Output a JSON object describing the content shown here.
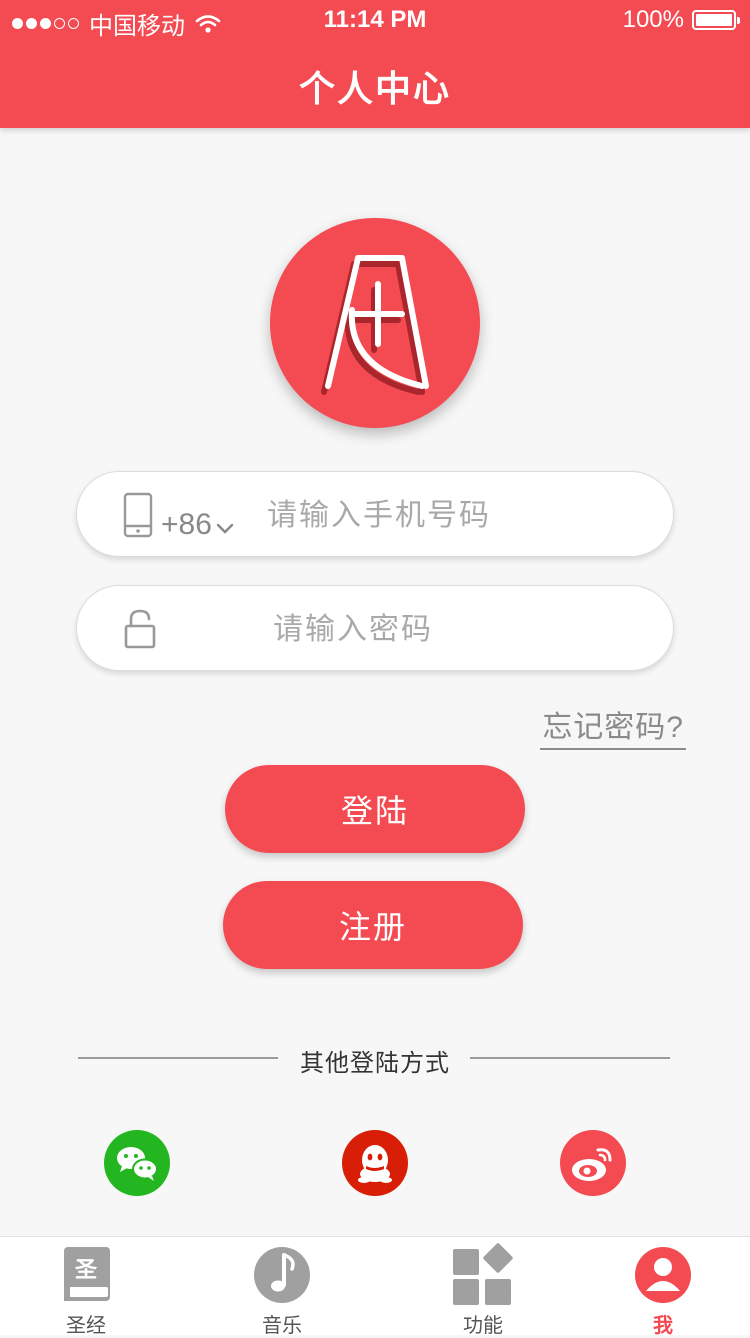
{
  "status_bar": {
    "carrier": "中国移动",
    "time": "11:14 PM",
    "battery": "100%",
    "signal_dots_filled": 3,
    "signal_dots_total": 5
  },
  "header": {
    "title": "个人中心"
  },
  "login_form": {
    "country_code": "+86",
    "phone_placeholder": "请输入手机号码",
    "phone_value": "",
    "password_placeholder": "请输入密码",
    "password_value": "",
    "forgot_password": "忘记密码?",
    "login_button": "登陆",
    "register_button": "注册"
  },
  "other_login": {
    "title": "其他登陆方式",
    "providers": [
      "wechat-icon",
      "qq-icon",
      "weibo-icon"
    ]
  },
  "tab_bar": {
    "items": [
      {
        "label": "圣经",
        "icon": "bible-book-icon",
        "badge": "圣",
        "active": false
      },
      {
        "label": "音乐",
        "icon": "music-note-icon",
        "active": false
      },
      {
        "label": "功能",
        "icon": "grid-functions-icon",
        "active": false
      },
      {
        "label": "我",
        "icon": "user-profile-icon",
        "active": true
      }
    ]
  },
  "colors": {
    "primary": "#f44a52",
    "wechat": "#23b621",
    "qq": "#d81e06",
    "background": "#f7f7f7",
    "icon_gray": "#a0a0a0"
  }
}
